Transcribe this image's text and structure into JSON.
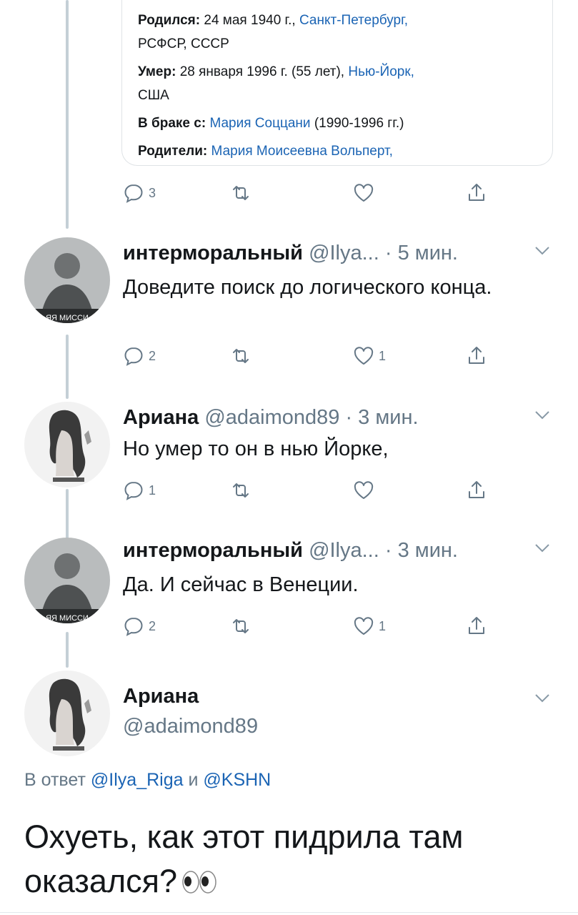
{
  "card": {
    "born_label": "Родился:",
    "born_date": "24 мая 1940 г.,",
    "born_place": "Санкт-Петербург,",
    "born_place2": "РСФСР, СССР",
    "died_label": "Умер:",
    "died_date": "28 января 1996 г. (55 лет),",
    "died_place": "Нью-Йорк,",
    "died_place2": "США",
    "spouse_label": "В браке с:",
    "spouse_name": "Мария Соццани",
    "spouse_years": "(1990-1996 гг.)",
    "parents_label": "Родители:",
    "parents_name": "Мария Моисеевна Вольперт,"
  },
  "actions_top": {
    "reply_count": "3",
    "like_count": ""
  },
  "tweets": [
    {
      "name": "интерморальный",
      "handle": "@Ilya...",
      "time": "· 5 мин.",
      "text": "Доведите поиск до логического конца.",
      "avatar_caption": "ЯЯ МИССИ",
      "reply_count": "2",
      "like_count": "1"
    },
    {
      "name": "Ариана",
      "handle": "@adaimond89",
      "time": "· 3 мин.",
      "text": "Но умер то он в нью Йорке,",
      "reply_count": "1",
      "like_count": ""
    },
    {
      "name": "интерморальный",
      "handle": "@Ilya...",
      "time": "· 3 мин.",
      "text": "Да. И сейчас в Венеции.",
      "avatar_caption": "ЯЯ МИССИ",
      "reply_count": "2",
      "like_count": "1"
    }
  ],
  "main_tweet": {
    "name": "Ариана",
    "handle": "@adaimond89",
    "reply_prefix": "В ответ",
    "reply_user1": "@Ilya_Riga",
    "reply_and": "и",
    "reply_user2": "@KSHN",
    "text": "Охуеть, как этот пидрила там оказался?",
    "emoji": "eyes-emoji"
  },
  "colors": {
    "link": "#1b64b4",
    "muted": "#657786",
    "thread_line": "#c4cfd6"
  }
}
